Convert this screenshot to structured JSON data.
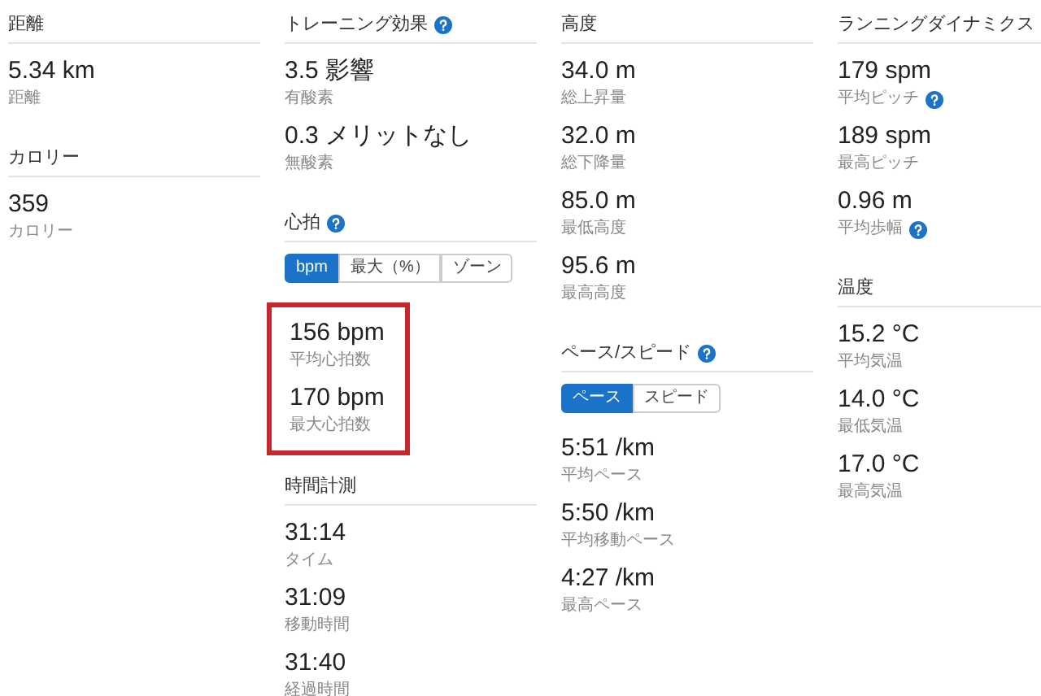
{
  "columns": [
    {
      "sections": [
        {
          "title": "距離",
          "help": false,
          "stats": [
            {
              "value": "5.34 km",
              "label": "距離",
              "help": false
            }
          ]
        },
        {
          "title": "カロリー",
          "help": false,
          "stats": [
            {
              "value": "359",
              "label": "カロリー",
              "help": false
            }
          ]
        }
      ]
    },
    {
      "sections": [
        {
          "title": "トレーニング効果",
          "help": true,
          "stats": [
            {
              "value": "3.5 影響",
              "label": "有酸素",
              "help": false
            },
            {
              "value": "0.3 メリットなし",
              "label": "無酸素",
              "help": false
            }
          ]
        },
        {
          "title": "心拍",
          "help": true,
          "toggle": [
            {
              "label": "bpm",
              "selected": true
            },
            {
              "label": "最大（%）",
              "selected": false
            },
            {
              "label": "ゾーン",
              "selected": false
            }
          ],
          "highlighted": true,
          "stats": [
            {
              "value": "156 bpm",
              "label": "平均心拍数",
              "help": false
            },
            {
              "value": "170 bpm",
              "label": "最大心拍数",
              "help": false
            }
          ]
        },
        {
          "title": "時間計測",
          "help": false,
          "stats": [
            {
              "value": "31:14",
              "label": "タイム",
              "help": false
            },
            {
              "value": "31:09",
              "label": "移動時間",
              "help": false
            },
            {
              "value": "31:40",
              "label": "経過時間",
              "help": false
            }
          ]
        }
      ]
    },
    {
      "sections": [
        {
          "title": "高度",
          "help": false,
          "stats": [
            {
              "value": "34.0 m",
              "label": "総上昇量",
              "help": false
            },
            {
              "value": "32.0 m",
              "label": "総下降量",
              "help": false
            },
            {
              "value": "85.0 m",
              "label": "最低高度",
              "help": false
            },
            {
              "value": "95.6 m",
              "label": "最高高度",
              "help": false
            }
          ]
        },
        {
          "title": "ペース/スピード",
          "help": true,
          "toggle": [
            {
              "label": "ペース",
              "selected": true
            },
            {
              "label": "スピード",
              "selected": false
            }
          ],
          "stats": [
            {
              "value": "5:51 /km",
              "label": "平均ペース",
              "help": false
            },
            {
              "value": "5:50 /km",
              "label": "平均移動ペース",
              "help": false
            },
            {
              "value": "4:27 /km",
              "label": "最高ペース",
              "help": false
            }
          ]
        }
      ]
    },
    {
      "sections": [
        {
          "title": "ランニングダイナミクス",
          "help": false,
          "stats": [
            {
              "value": "179 spm",
              "label": "平均ピッチ",
              "help": true
            },
            {
              "value": "189 spm",
              "label": "最高ピッチ",
              "help": false
            },
            {
              "value": "0.96 m",
              "label": "平均歩幅",
              "help": true
            }
          ]
        },
        {
          "title": "温度",
          "help": false,
          "stats": [
            {
              "value": "15.2 °C",
              "label": "平均気温",
              "help": false
            },
            {
              "value": "14.0 °C",
              "label": "最低気温",
              "help": false
            },
            {
              "value": "17.0 °C",
              "label": "最高気温",
              "help": false
            }
          ]
        }
      ]
    }
  ]
}
